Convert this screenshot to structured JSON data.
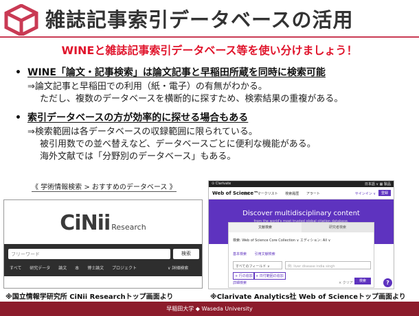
{
  "header": {
    "title": "雑誌記事索引データベースの活用",
    "accent_color": "#c93a54"
  },
  "headline": "WINEと雑誌記事索引データベース等を使い分けましょう！",
  "bullets": [
    {
      "text": "WINE「論文・記事検索」は論文記事と早稲田所蔵を同時に検索可能",
      "lines": [
        "⇒論文記事と早稲田での利用（紙・電子）の有無がわかる。",
        "ただし、複数のデータベースを横断的に探すため、検索結果の重複がある。"
      ]
    },
    {
      "text": "索引データベースの方が効率的に探せる場合もある",
      "lines": [
        "⇒検索範囲は各データベースの収録範囲に限られている。",
        "被引用数での並べ替えなど、データベースごとに便利な機能がある。",
        "海外文献では「分野別のデータベース」もある。"
      ]
    }
  ],
  "link_caption": "《 学術情報検索 > おすすめのデータベース 》",
  "cinii": {
    "logo": "CiNii",
    "logo_sub": "Research",
    "placeholder": "フリーワード",
    "search_button": "検索",
    "tabs": [
      "すべて",
      "研究データ",
      "論文",
      "本",
      "博士論文",
      "プロジェクト"
    ],
    "advanced": "∨ 詳細検索",
    "caption": "※国立情報学研究所 CiNii Researchトップ画面より"
  },
  "wos": {
    "topbar_left": "⊙ Clarivate",
    "topbar_right": "日本語 ∨   ▦ 製品",
    "brand": "Web of Science™",
    "nav_items": [
      "検索",
      "マークリスト",
      "検索履歴",
      "アラート"
    ],
    "signin": "サインイン ∨",
    "register": "登録",
    "hero_title": "Discover multidisciplinary content",
    "hero_subtitle": "from the world's most trusted global citation database.",
    "tab_docs": "文献検索",
    "tab_researchers": "研究者検索",
    "database": "検索: Web of Science Core Collection ∨   エディション: All ∨",
    "subtabs": [
      "基本検索",
      "引用文献検索"
    ],
    "field": "すべてのフィールド  ∨",
    "query_placeholder": "例: liver disease india singh",
    "add_row": "+ 行の追加",
    "add_date": "+ 日付範囲の追加",
    "advanced": "詳細検索",
    "clear": "× クリア",
    "search": "検索",
    "help": "?",
    "caption": "※Clarivate Analytics社 Web of Scienceトップ画面より",
    "brand_color": "#5e33bf"
  },
  "footer": "早稲田大学 ◆ Waseda University",
  "footer_color": "#8c1c2b"
}
